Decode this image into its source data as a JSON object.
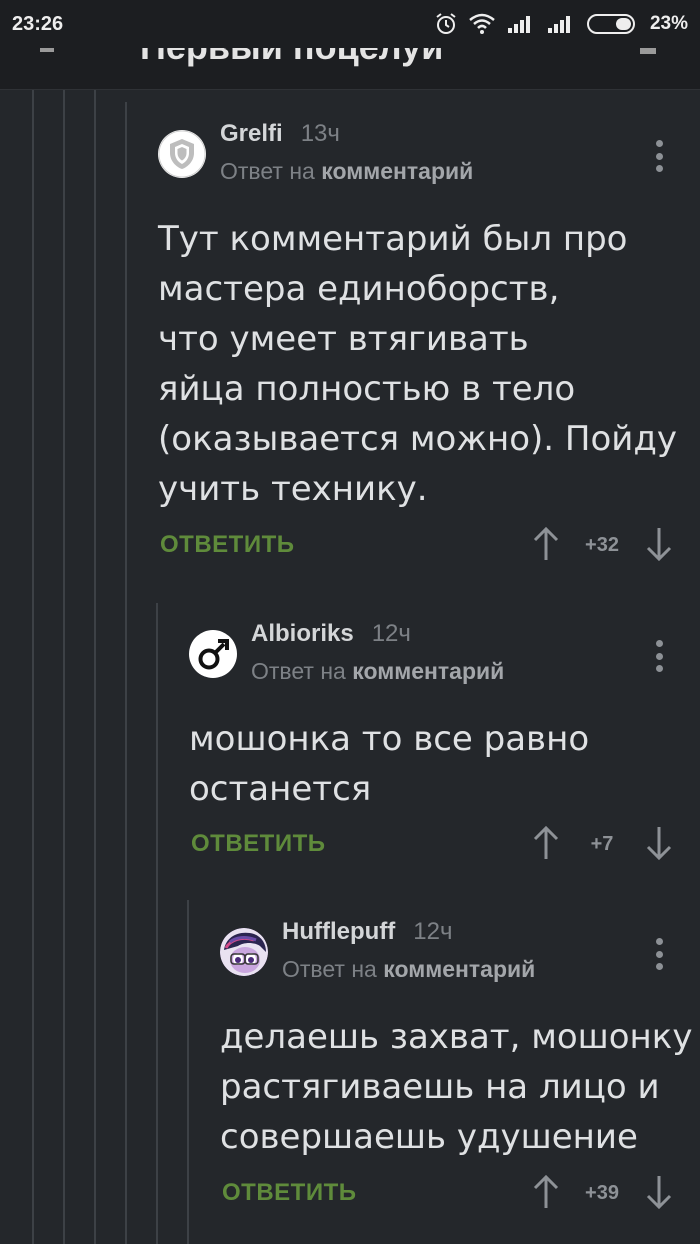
{
  "status_bar": {
    "time": "23:26",
    "battery_percent": "23%",
    "icons": [
      "alarm-icon",
      "wifi-icon",
      "signal-icon",
      "signal-icon",
      "battery-icon"
    ]
  },
  "header": {
    "title_fragment": "Первый поцелуй"
  },
  "colors": {
    "background": "#24272b",
    "reply_action": "#5f8b3b",
    "thread_line": "#3d4146"
  },
  "comments": [
    {
      "author": "Grelfi",
      "time": "13ч",
      "reply_prefix": "Ответ на",
      "reply_target": "комментарий",
      "lines": [
        "Тут комментарий был про",
        "мастера единоборств,",
        "что умеет втягивать",
        "яйца полностью в тело",
        "(оказывается можно). Пойду",
        "учить технику."
      ],
      "reply_label": "ОТВЕТИТЬ",
      "rating": "+32",
      "avatar_icon": "shield-icon"
    },
    {
      "author": "Albioriks",
      "time": "12ч",
      "reply_prefix": "Ответ на",
      "reply_target": "комментарий",
      "lines": [
        "мошонка то все равно",
        "останется"
      ],
      "reply_label": "ОТВЕТИТЬ",
      "rating": "+7",
      "avatar_icon": "male-symbol-icon"
    },
    {
      "author": "Hufflepuff",
      "time": "12ч",
      "reply_prefix": "Ответ на",
      "reply_target": "комментарий",
      "lines": [
        "делаешь захват, мошонку",
        "растягиваешь на лицо и",
        "совершаешь удушение"
      ],
      "reply_label": "ОТВЕТИТЬ",
      "rating": "+39",
      "avatar_icon": "pony-avatar-icon"
    }
  ]
}
